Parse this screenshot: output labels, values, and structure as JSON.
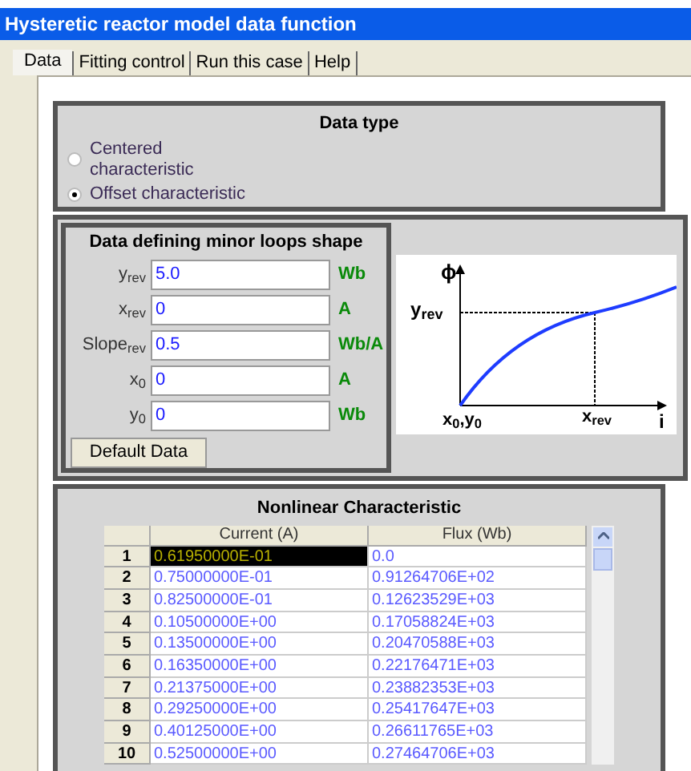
{
  "window": {
    "title": "Hysteretic reactor model data function"
  },
  "tabs": [
    {
      "label": "Data",
      "selected": true
    },
    {
      "label": "Fitting control",
      "selected": false
    },
    {
      "label": "Run this case",
      "selected": false
    },
    {
      "label": "Help",
      "selected": false
    }
  ],
  "data_type": {
    "title": "Data type",
    "options": [
      {
        "label": "Centered characteristic",
        "selected": false
      },
      {
        "label": "Offset characteristic",
        "selected": true
      }
    ]
  },
  "minor_loops": {
    "title": "Data defining minor loops shape",
    "fields": [
      {
        "label": "y$_{rev}$",
        "value": "5.0",
        "unit": "Wb"
      },
      {
        "label": "x$_{rev}$",
        "value": "0",
        "unit": "A"
      },
      {
        "label": "Slope$_{rev}$",
        "value": "0.5",
        "unit": "Wb/A"
      },
      {
        "label": "x$_{0}$",
        "value": "0",
        "unit": "A"
      },
      {
        "label": "y$_{0}$",
        "value": "0",
        "unit": "Wb"
      }
    ],
    "button": "Default Data"
  },
  "diagram": {
    "y_axis": "ϕ",
    "y_mark": "y$_{rev}$",
    "origin": "x$_{0}$,y$_{0}$",
    "x_mark": "x$_{rev}$",
    "x_axis": "i"
  },
  "table": {
    "title": "Nonlinear Characteristic",
    "columns": [
      "Current (A)",
      "Flux (Wb)"
    ],
    "rows": [
      {
        "index": "1",
        "current": "0.61950000E-01",
        "flux": "0.0",
        "selected": true
      },
      {
        "index": "2",
        "current": "0.75000000E-01",
        "flux": "0.91264706E+02",
        "selected": false
      },
      {
        "index": "3",
        "current": "0.82500000E-01",
        "flux": "0.12623529E+03",
        "selected": false
      },
      {
        "index": "4",
        "current": "0.10500000E+00",
        "flux": "0.17058824E+03",
        "selected": false
      },
      {
        "index": "5",
        "current": "0.13500000E+00",
        "flux": "0.20470588E+03",
        "selected": false
      },
      {
        "index": "6",
        "current": "0.16350000E+00",
        "flux": "0.22176471E+03",
        "selected": false
      },
      {
        "index": "7",
        "current": "0.21375000E+00",
        "flux": "0.23882353E+03",
        "selected": false
      },
      {
        "index": "8",
        "current": "0.29250000E+00",
        "flux": "0.25417647E+03",
        "selected": false
      },
      {
        "index": "9",
        "current": "0.40125000E+00",
        "flux": "0.26611765E+03",
        "selected": false
      },
      {
        "index": "10",
        "current": "0.52500000E+00",
        "flux": "0.27464706E+03",
        "selected": false
      }
    ]
  }
}
